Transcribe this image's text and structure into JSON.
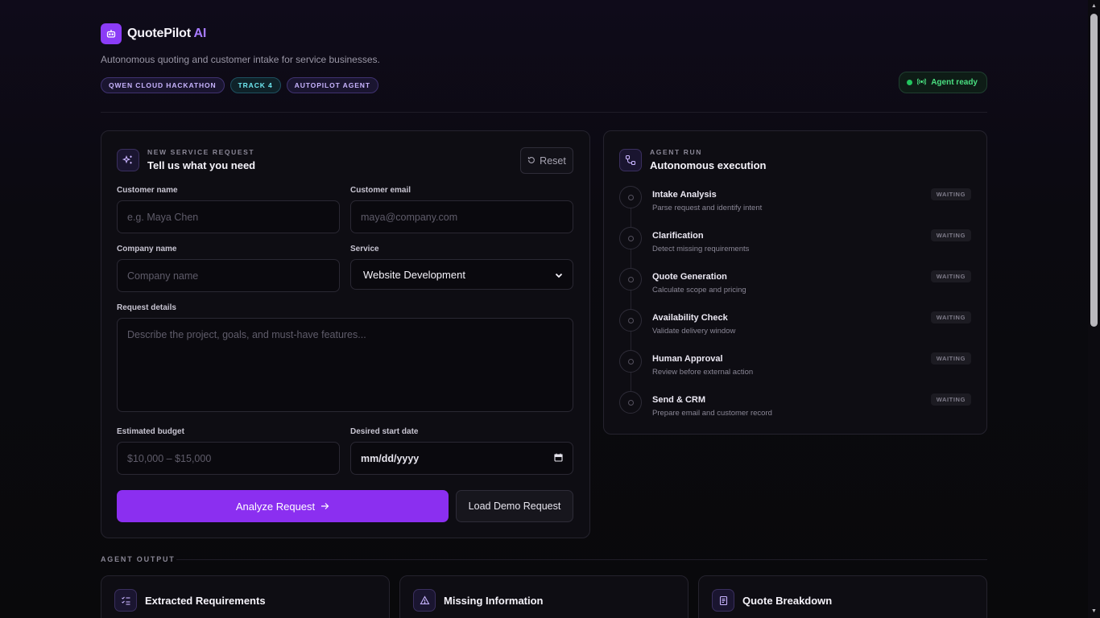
{
  "app": {
    "name_main": "QuotePilot",
    "name_accent": "AI",
    "tagline": "Autonomous quoting and customer intake for service businesses.",
    "badges": [
      "QWEN CLOUD HACKATHON",
      "TRACK 4",
      "AUTOPILOT AGENT"
    ],
    "status": "Agent ready",
    "colors": {
      "accent": "#8b2ff0",
      "ready": "#22c55e"
    }
  },
  "form": {
    "eyebrow": "NEW SERVICE REQUEST",
    "title": "Tell us what you need",
    "reset_label": "Reset",
    "customer_name": {
      "label": "Customer name",
      "placeholder": "e.g. Maya Chen"
    },
    "customer_email": {
      "label": "Customer email",
      "placeholder": "maya@company.com"
    },
    "company_name": {
      "label": "Company name",
      "placeholder": "Company name"
    },
    "service": {
      "label": "Service",
      "value": "Website Development"
    },
    "request_details": {
      "label": "Request details",
      "placeholder": "Describe the project, goals, and must-have features..."
    },
    "budget": {
      "label": "Estimated budget",
      "placeholder": "$10,000 – $15,000"
    },
    "start_date": {
      "label": "Desired start date",
      "placeholder": "mm/dd/yyyy"
    },
    "analyze_label": "Analyze Request",
    "demo_label": "Load Demo Request"
  },
  "run": {
    "eyebrow": "AGENT RUN",
    "title": "Autonomous execution",
    "steps": [
      {
        "name": "Intake Analysis",
        "desc": "Parse request and identify intent",
        "status": "WAITING"
      },
      {
        "name": "Clarification",
        "desc": "Detect missing requirements",
        "status": "WAITING"
      },
      {
        "name": "Quote Generation",
        "desc": "Calculate scope and pricing",
        "status": "WAITING"
      },
      {
        "name": "Availability Check",
        "desc": "Validate delivery window",
        "status": "WAITING"
      },
      {
        "name": "Human Approval",
        "desc": "Review before external action",
        "status": "WAITING"
      },
      {
        "name": "Send & CRM",
        "desc": "Prepare email and customer record",
        "status": "WAITING"
      }
    ]
  },
  "output": {
    "label": "AGENT OUTPUT",
    "cards": [
      {
        "title": "Extracted Requirements",
        "icon": "list-check-icon"
      },
      {
        "title": "Missing Information",
        "icon": "warning-icon"
      },
      {
        "title": "Quote Breakdown",
        "icon": "receipt-icon"
      }
    ]
  }
}
